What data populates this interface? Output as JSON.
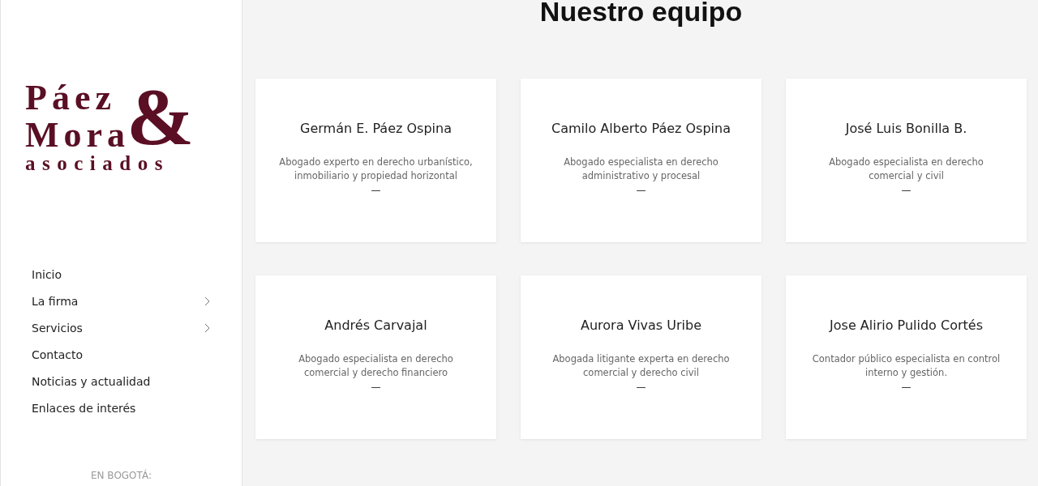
{
  "sidebar": {
    "logo": {
      "line_1": "Páez",
      "line_2": "Mora",
      "ampersand": "&",
      "line_3": "asociados"
    },
    "nav": [
      {
        "label": "Inicio",
        "has_submenu": false
      },
      {
        "label": "La firma",
        "has_submenu": true
      },
      {
        "label": "Servicios",
        "has_submenu": true
      },
      {
        "label": "Contacto",
        "has_submenu": false
      },
      {
        "label": "Noticias y actualidad",
        "has_submenu": false
      },
      {
        "label": "Enlaces de interés",
        "has_submenu": false
      }
    ],
    "footer_heading": "EN BOGOTÁ:"
  },
  "main": {
    "title": "Nuestro equipo",
    "team": [
      {
        "name": "Germán E. Páez Ospina",
        "role": "Abogado experto en derecho urbanístico, inmobiliario y propiedad horizontal",
        "separator": "—"
      },
      {
        "name": "Camilo Alberto Páez Ospina",
        "role": "Abogado especialista en derecho administrativo y procesal",
        "separator": "—"
      },
      {
        "name": "José Luis Bonilla B.",
        "role": "Abogado especialista en derecho comercial y civil",
        "separator": "—"
      },
      {
        "name": "Andrés Carvajal",
        "role": "Abogado especialista en derecho comercial y derecho financiero",
        "separator": "—"
      },
      {
        "name": "Aurora Vivas Uribe",
        "role": "Abogada litigante experta en derecho comercial y derecho civil",
        "separator": "—"
      },
      {
        "name": "Jose Alirio Pulido Cortés",
        "role": "Contador público especialista en control interno y gestión.",
        "separator": "—"
      }
    ]
  }
}
